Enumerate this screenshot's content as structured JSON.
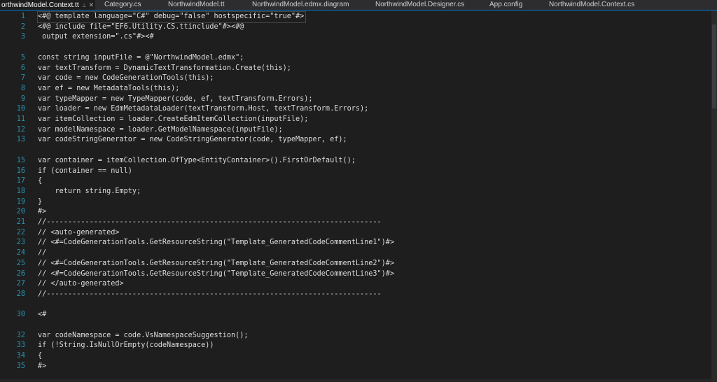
{
  "tabs": [
    {
      "label": "orthwindModel.Context.tt",
      "active": true
    },
    {
      "label": "Category.cs",
      "active": false
    },
    {
      "label": "NorthwindModel.tt",
      "active": false
    },
    {
      "label": "NorthwindModel.edmx.diagram",
      "active": false
    },
    {
      "label": "NorthwindModel.Designer.cs",
      "active": false
    },
    {
      "label": "App.config",
      "active": false
    },
    {
      "label": "NorthwindModel.Context.cs",
      "active": false
    }
  ],
  "colors": {
    "background": "#1e1e1e",
    "line_number": "#2b91af",
    "code_text": "#dcdcdc",
    "accent": "#007acc"
  },
  "code_lines": [
    {
      "n": "1",
      "text": "<#@ template language=\"C#\" debug=\"false\" hostspecific=\"true\"#>"
    },
    {
      "n": "2",
      "text": "<#@ include file=\"EF6.Utility.CS.ttinclude\"#><#@"
    },
    {
      "n": "3",
      "text": " output extension=\".cs\"#><#"
    },
    {
      "n": "",
      "text": ""
    },
    {
      "n": "5",
      "text": "const string inputFile = @\"NorthwindModel.edmx\";"
    },
    {
      "n": "6",
      "text": "var textTransform = DynamicTextTransformation.Create(this);"
    },
    {
      "n": "7",
      "text": "var code = new CodeGenerationTools(this);"
    },
    {
      "n": "8",
      "text": "var ef = new MetadataTools(this);"
    },
    {
      "n": "9",
      "text": "var typeMapper = new TypeMapper(code, ef, textTransform.Errors);"
    },
    {
      "n": "10",
      "text": "var loader = new EdmMetadataLoader(textTransform.Host, textTransform.Errors);"
    },
    {
      "n": "11",
      "text": "var itemCollection = loader.CreateEdmItemCollection(inputFile);"
    },
    {
      "n": "12",
      "text": "var modelNamespace = loader.GetModelNamespace(inputFile);"
    },
    {
      "n": "13",
      "text": "var codeStringGenerator = new CodeStringGenerator(code, typeMapper, ef);"
    },
    {
      "n": "",
      "text": ""
    },
    {
      "n": "15",
      "text": "var container = itemCollection.OfType<EntityContainer>().FirstOrDefault();"
    },
    {
      "n": "16",
      "text": "if (container == null)"
    },
    {
      "n": "17",
      "text": "{"
    },
    {
      "n": "18",
      "text": "    return string.Empty;"
    },
    {
      "n": "19",
      "text": "}"
    },
    {
      "n": "20",
      "text": "#>"
    },
    {
      "n": "21",
      "text": "//------------------------------------------------------------------------------"
    },
    {
      "n": "22",
      "text": "// <auto-generated>"
    },
    {
      "n": "23",
      "text": "// <#=CodeGenerationTools.GetResourceString(\"Template_GeneratedCodeCommentLine1\")#>"
    },
    {
      "n": "24",
      "text": "//"
    },
    {
      "n": "25",
      "text": "// <#=CodeGenerationTools.GetResourceString(\"Template_GeneratedCodeCommentLine2\")#>"
    },
    {
      "n": "26",
      "text": "// <#=CodeGenerationTools.GetResourceString(\"Template_GeneratedCodeCommentLine3\")#>"
    },
    {
      "n": "27",
      "text": "// </auto-generated>"
    },
    {
      "n": "28",
      "text": "//------------------------------------------------------------------------------"
    },
    {
      "n": "",
      "text": ""
    },
    {
      "n": "30",
      "text": "<#"
    },
    {
      "n": "",
      "text": ""
    },
    {
      "n": "32",
      "text": "var codeNamespace = code.VsNamespaceSuggestion();"
    },
    {
      "n": "33",
      "text": "if (!String.IsNullOrEmpty(codeNamespace))"
    },
    {
      "n": "34",
      "text": "{"
    },
    {
      "n": "35",
      "text": "#>"
    }
  ]
}
